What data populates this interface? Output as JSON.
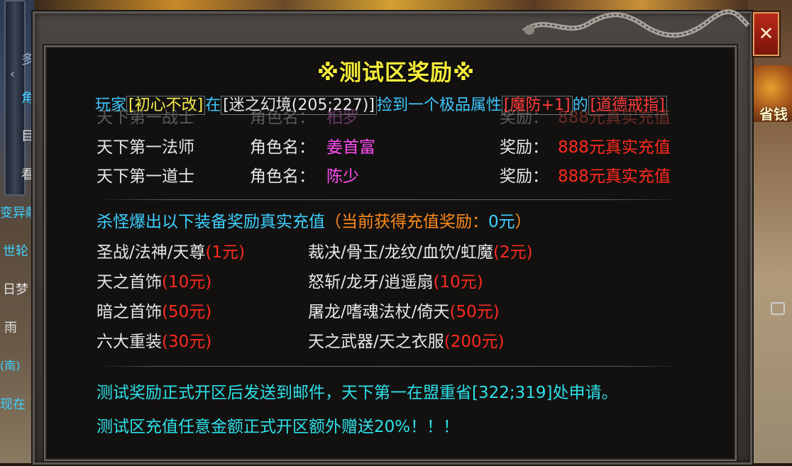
{
  "window": {
    "title": "※测试区奖励※"
  },
  "background": {
    "left_texts": [
      "多",
      "角",
      "目",
      "看",
      "变异献",
      "世轮",
      "日梦",
      "雨",
      "(南)",
      "现在"
    ],
    "right_label": "省钱"
  },
  "broadcast": {
    "prefix": "玩家",
    "player": "[初心不改]",
    "at": "在",
    "map": "[迷之幻境(205;227)]",
    "picked": "捡到一个极品属性",
    "attr": "[魔防+1]",
    "of": "的",
    "item": "[道德戒指]"
  },
  "rankings": [
    {
      "title": "天下第一战士",
      "name_label": "角色名：",
      "name": "桕罗",
      "reward_label": "奖励：",
      "reward": "888元真实充值"
    },
    {
      "title": "天下第一法师",
      "name_label": "角色名：",
      "name": "姜首富",
      "reward_label": "奖励：",
      "reward": "888元真实充值"
    },
    {
      "title": "天下第一道士",
      "name_label": "角色名：",
      "name": "陈少",
      "reward_label": "奖励：",
      "reward": "888元真实充值"
    }
  ],
  "drop_rewards": {
    "heading": "杀怪爆出以下装备奖励真实充值",
    "current_prefix": "（当前获得充值奖励：",
    "current_value": "0元",
    "current_suffix": "）",
    "left": [
      {
        "name": "圣战/法神/天尊",
        "reward": "(1元)"
      },
      {
        "name": "天之首饰",
        "reward": "(10元)"
      },
      {
        "name": "暗之首饰",
        "reward": "(50元)"
      },
      {
        "name": "六大重装",
        "reward": "(30元)"
      }
    ],
    "right": [
      {
        "name": "裁决/骨玉/龙纹/血饮/虹魔",
        "reward": "(2元)"
      },
      {
        "name": "怒斩/龙牙/逍遥扇",
        "reward": "(10元)"
      },
      {
        "name": "屠龙/嗜魂法杖/倚天",
        "reward": "(50元)"
      },
      {
        "name": "天之武器/天之衣服",
        "reward": "(200元)"
      }
    ]
  },
  "notes": [
    "测试奖励正式开区后发送到邮件，天下第一在盟重省[322;319]处申请。",
    "测试区充值任意金额正式开区额外赠送20%！！！"
  ],
  "close_button": {
    "symbol": "✕"
  },
  "colors": {
    "title": "#f5ec3c",
    "cyan": "#3ed0ff",
    "magenta": "#ff4cf4",
    "red": "#ff2a1e",
    "orange": "#ff8a1a"
  }
}
